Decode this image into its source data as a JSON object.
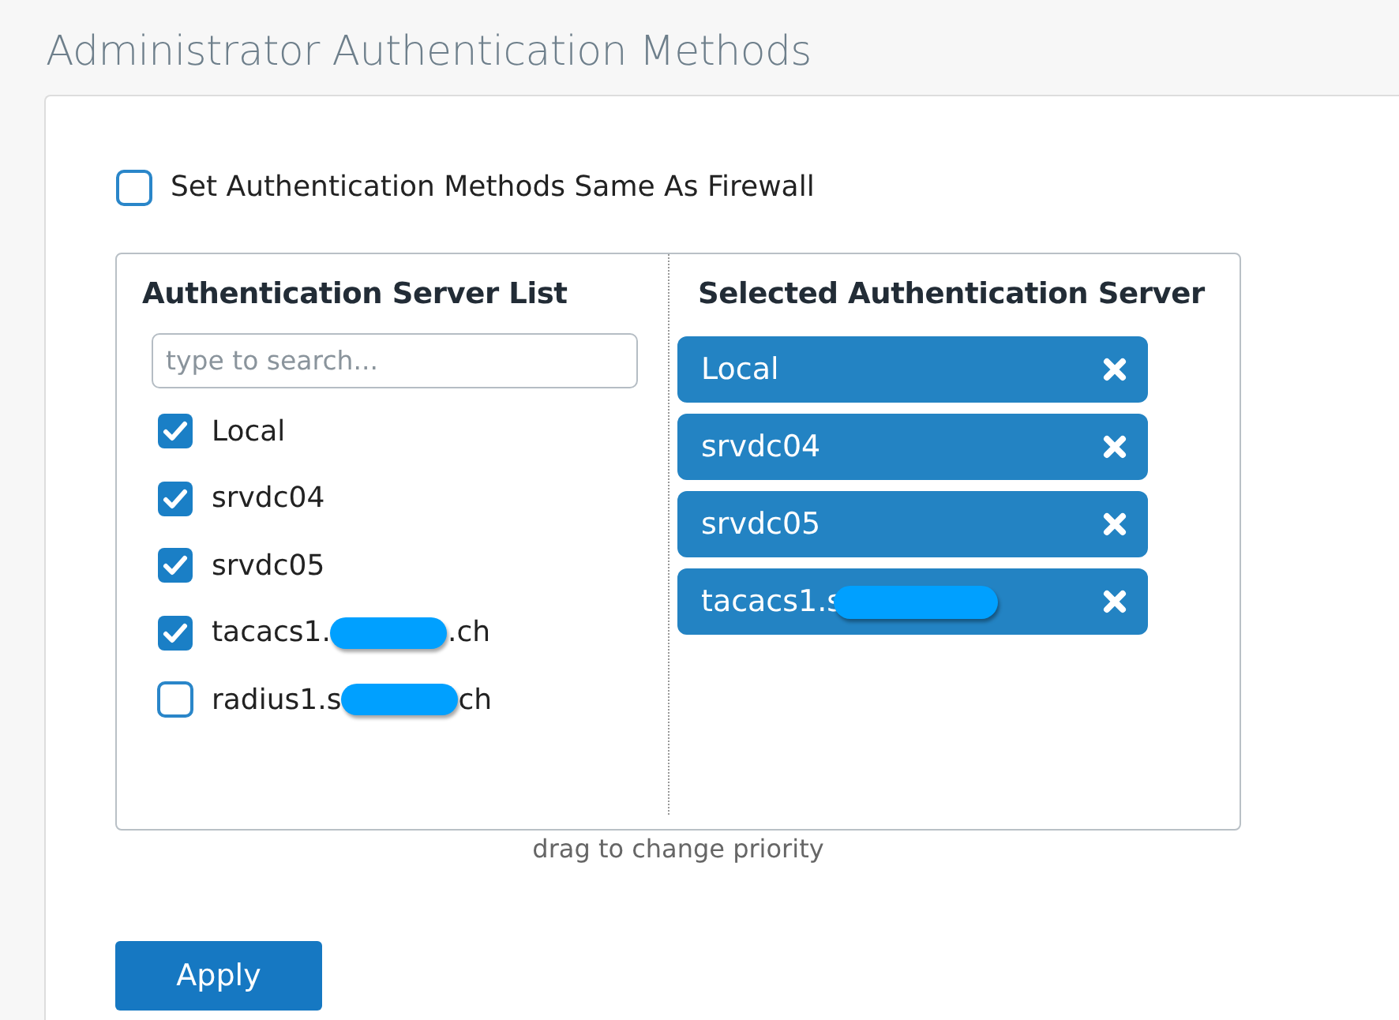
{
  "page_title": "Administrator Authentication Methods",
  "same_as_firewall": {
    "label": "Set Authentication Methods Same As Firewall",
    "checked": false
  },
  "server_list": {
    "heading": "Authentication Server List",
    "search": {
      "placeholder": "type to search..."
    },
    "items": [
      {
        "label": "Local",
        "checked": true,
        "redacted": false
      },
      {
        "label": "srvdc04",
        "checked": true,
        "redacted": false
      },
      {
        "label": "srvdc05",
        "checked": true,
        "redacted": false
      },
      {
        "label": "tacacs1.",
        "label_end": ".ch",
        "checked": true,
        "redacted": true
      },
      {
        "label": "radius1.s",
        "label_end": "ch",
        "checked": false,
        "redacted": true
      }
    ]
  },
  "selected_servers": {
    "heading": "Selected Authentication Server",
    "items": [
      {
        "label": "Local",
        "redacted": false
      },
      {
        "label": "srvdc04",
        "redacted": false
      },
      {
        "label": "srvdc05",
        "redacted": false
      },
      {
        "label": "tacacs1.s",
        "redacted": true
      }
    ]
  },
  "hint": "drag to change priority",
  "apply_button": "Apply"
}
